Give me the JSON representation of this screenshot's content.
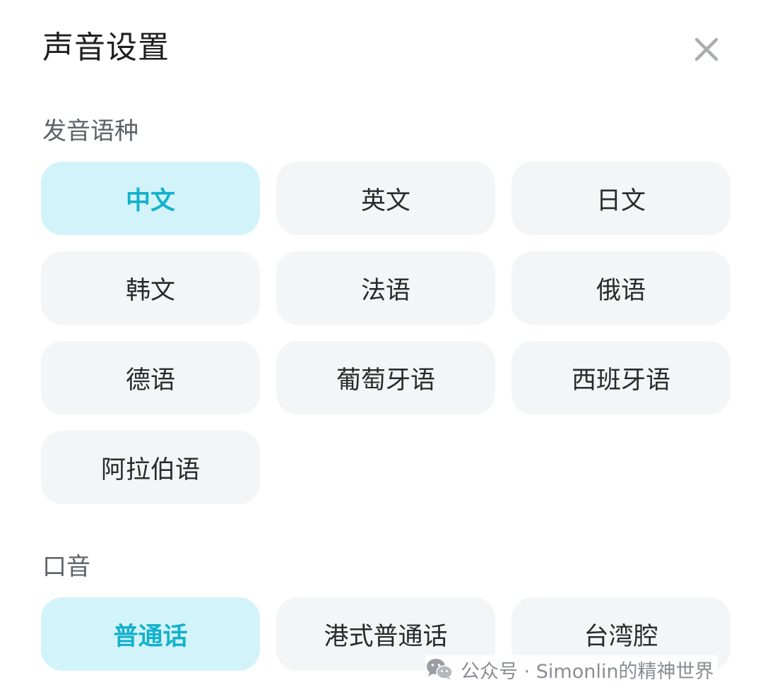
{
  "dialog": {
    "title": "声音设置",
    "close_icon": "close-icon"
  },
  "language_section": {
    "label": "发音语种",
    "selected": "中文",
    "options": [
      "中文",
      "英文",
      "日文",
      "韩文",
      "法语",
      "俄语",
      "德语",
      "葡萄牙语",
      "西班牙语",
      "阿拉伯语"
    ]
  },
  "accent_section": {
    "label": "口音",
    "selected": "普通话",
    "options": [
      "普通话",
      "港式普通话",
      "台湾腔"
    ]
  },
  "watermark": {
    "icon": "wechat-icon",
    "text": "公众号 · Simonlin的精神世界"
  },
  "colors": {
    "selected_bg": "#d2f3fa",
    "selected_text": "#12b1cc",
    "chip_bg": "#f3f5f6"
  }
}
